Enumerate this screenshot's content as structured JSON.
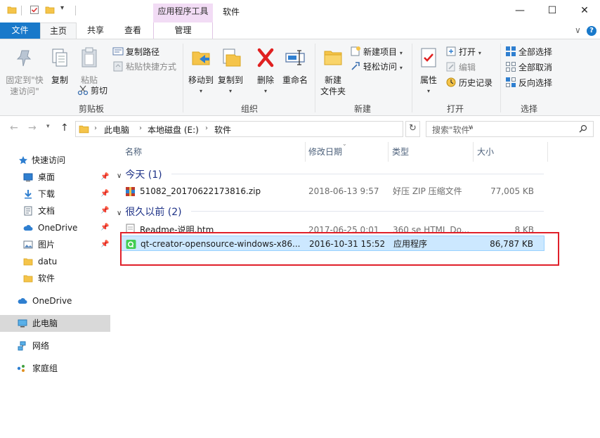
{
  "titlebar": {
    "context_tab": "应用程序工具",
    "window_title": "软件",
    "minimize": "—",
    "maximize": "☐",
    "close": "✕"
  },
  "tabs": {
    "file": "文件",
    "home": "主页",
    "share": "共享",
    "view": "查看",
    "manage": "管理",
    "toggle": "∨",
    "help": "?"
  },
  "ribbon": {
    "clipboard": {
      "label": "剪贴板",
      "pin_quick_access": "固定到\"快\n速访问\"",
      "copy": "复制",
      "paste": "粘贴",
      "copy_path": "复制路径",
      "paste_shortcut": "粘贴快捷方式",
      "cut": "剪切"
    },
    "organize": {
      "label": "组织",
      "move_to": "移动到",
      "copy_to": "复制到",
      "delete": "删除",
      "rename": "重命名"
    },
    "new": {
      "label": "新建",
      "new_folder": "新建\n文件夹",
      "new_item": "新建项目",
      "easy_access": "轻松访问"
    },
    "open": {
      "label": "打开",
      "properties": "属性",
      "open": "打开",
      "edit": "编辑",
      "history": "历史记录"
    },
    "select": {
      "label": "选择",
      "select_all": "全部选择",
      "select_none": "全部取消",
      "invert": "反向选择"
    }
  },
  "address": {
    "crumbs": [
      "此电脑",
      "本地磁盘 (E:)",
      "软件"
    ],
    "search_placeholder": "搜索\"软件\""
  },
  "nav": {
    "quick_access": "快速访问",
    "items": [
      {
        "label": "桌面",
        "pinned": true
      },
      {
        "label": "下载",
        "pinned": true
      },
      {
        "label": "文档",
        "pinned": true
      },
      {
        "label": "OneDrive",
        "pinned": true
      },
      {
        "label": "图片",
        "pinned": true
      },
      {
        "label": "datu",
        "pinned": false
      },
      {
        "label": "软件",
        "pinned": false
      }
    ],
    "onedrive": "OneDrive",
    "this_pc": "此电脑",
    "network": "网络",
    "homegroup": "家庭组",
    "pin_glyph": "📌"
  },
  "filelist": {
    "columns": {
      "name": "名称",
      "date": "修改日期",
      "type": "类型",
      "size": "大小"
    },
    "groups": [
      {
        "title": "今天 (1)",
        "files": [
          {
            "name": "51082_20170622173816.zip",
            "date": "2018-06-13 9:57",
            "type": "好压 ZIP 压缩文件",
            "size": "77,005 KB",
            "icon": "zip-archive-icon"
          }
        ]
      },
      {
        "title": "很久以前 (2)",
        "files": [
          {
            "name": "Readme-说明.htm",
            "date": "2017-06-25 0:01",
            "type": "360 se HTML Do...",
            "size": "8 KB",
            "icon": "html-document-icon"
          },
          {
            "name": "qt-creator-opensource-windows-x86...",
            "date": "2016-10-31 15:52",
            "type": "应用程序",
            "size": "86,787 KB",
            "icon": "qt-installer-icon"
          }
        ]
      }
    ]
  },
  "colors": {
    "file_tab": "#1979ca",
    "context_tab": "#f2dcf5",
    "selection": "#cce8ff",
    "highlight_box": "#e0202a",
    "group_title": "#1e3287"
  }
}
